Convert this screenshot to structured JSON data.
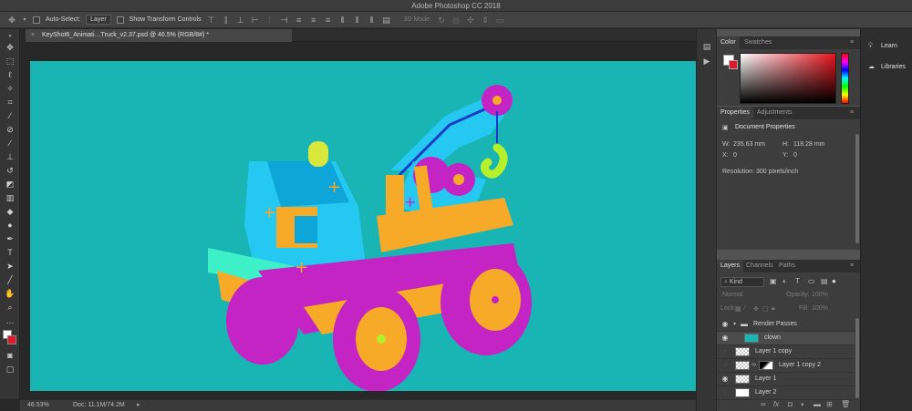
{
  "app": {
    "title": "Adobe Photoshop CC 2018"
  },
  "options_bar": {
    "auto_select_label": "Auto-Select:",
    "auto_select_value": "Layer",
    "transform_label": "Show Transform Controls",
    "mode_label": "3D Mode:"
  },
  "document": {
    "tab_title": "KeyShot6_Animati…Truck_v2.37.psd @ 46.5% (RGB/8#) *",
    "background_color": "#19b5b5"
  },
  "status_bar": {
    "zoom": "46.53%",
    "doc_size": "Doc: 11.1M/74.2M"
  },
  "color_panel": {
    "tabs": [
      "Color",
      "Swatches"
    ],
    "foreground": "#ffffff",
    "background": "#e0162b"
  },
  "properties_panel": {
    "tabs": [
      "Properties",
      "Adjustments"
    ],
    "title": "Document Properties",
    "w_label": "W:",
    "w_value": "235.63 mm",
    "h_label": "H:",
    "h_value": "118.28 mm",
    "x_label": "X:",
    "x_value": "0",
    "y_label": "Y:",
    "y_value": "0",
    "resolution": "Resolution: 300 pixels/inch"
  },
  "layers_panel": {
    "tabs": [
      "Layers",
      "Channels",
      "Paths"
    ],
    "filter_label": "Kind",
    "blend_mode": "Normal",
    "opacity_label": "Opacity:",
    "opacity_value": "100%",
    "lock_label": "Lock:",
    "fill_label": "Fill:",
    "fill_value": "100%",
    "layers": [
      {
        "name": "Render Passes",
        "visible": true,
        "type": "group"
      },
      {
        "name": "clown",
        "visible": true,
        "type": "teal"
      },
      {
        "name": "Layer 1 copy",
        "visible": false,
        "type": "checker"
      },
      {
        "name": "Layer 1 copy 2",
        "visible": false,
        "type": "mask"
      },
      {
        "name": "Layer 1",
        "visible": true,
        "type": "checker"
      },
      {
        "name": "Layer 2",
        "visible": false,
        "type": "white"
      }
    ]
  },
  "learn_panel": {
    "items": [
      "Learn",
      "Libraries"
    ]
  }
}
